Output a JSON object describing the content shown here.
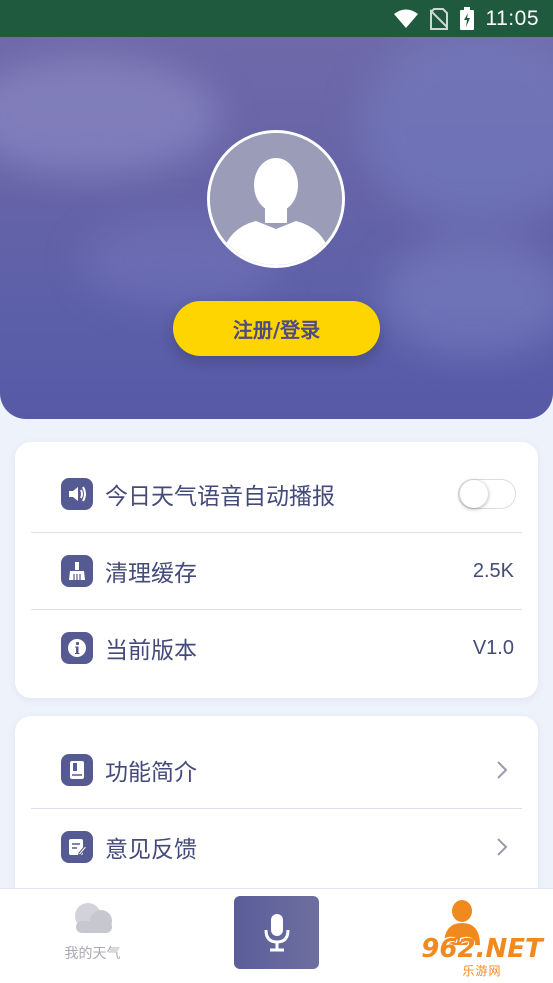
{
  "status_bar": {
    "time": "11:05",
    "icons": [
      "wifi-icon",
      "no-sim-icon",
      "battery-charging-icon"
    ]
  },
  "hero": {
    "avatar_icon": "user-silhouette-icon",
    "login_label": "注册/登录"
  },
  "settings": {
    "voice_broadcast": {
      "label": "今日天气语音自动播报",
      "icon": "speaker-icon",
      "enabled": false
    },
    "clear_cache": {
      "label": "清理缓存",
      "icon": "broom-icon",
      "value": "2.5K"
    },
    "version": {
      "label": "当前版本",
      "icon": "info-icon",
      "value": "V1.0"
    }
  },
  "more": {
    "intro": {
      "label": "功能简介",
      "icon": "book-icon"
    },
    "feedback": {
      "label": "意见反馈",
      "icon": "edit-note-icon"
    }
  },
  "nav": {
    "weather_label": "我的天气",
    "weather_icon": "cloud-icon",
    "voice_icon": "microphone-icon",
    "profile_icon": "person-icon"
  },
  "watermark": {
    "top": "962.NET",
    "bottom": "乐游网"
  },
  "colors": {
    "accent_yellow": "#ffd500",
    "primary": "#565a93",
    "hero": "#6663a8",
    "watermark": "#f08a1f"
  }
}
